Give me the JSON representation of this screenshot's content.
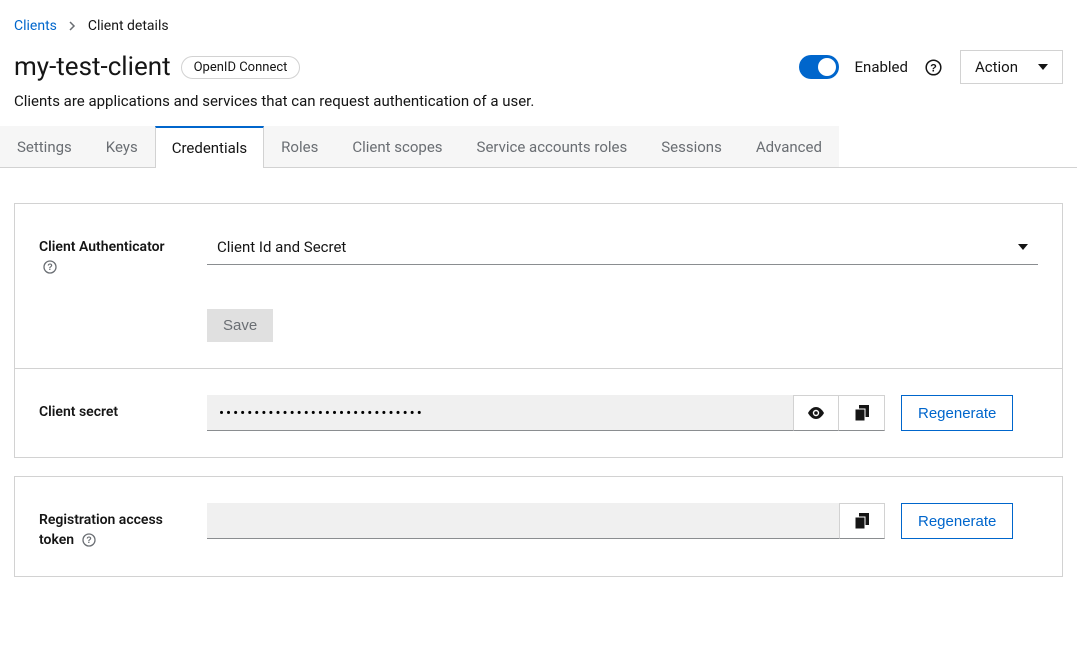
{
  "breadcrumb": {
    "root": "Clients",
    "current": "Client details"
  },
  "header": {
    "title": "my-test-client",
    "chip": "OpenID Connect",
    "enabled_label": "Enabled",
    "action_label": "Action"
  },
  "description": "Clients are applications and services that can request authentication of a user.",
  "tabs": {
    "settings": "Settings",
    "keys": "Keys",
    "credentials": "Credentials",
    "roles": "Roles",
    "client_scopes": "Client scopes",
    "service_accounts_roles": "Service accounts roles",
    "sessions": "Sessions",
    "advanced": "Advanced"
  },
  "form": {
    "authenticator": {
      "label": "Client Authenticator",
      "value": "Client Id and Secret",
      "save": "Save"
    },
    "secret": {
      "label": "Client secret",
      "value": "•••••••••••••••••••••••••••••",
      "regenerate": "Regenerate"
    },
    "registration_token": {
      "label": "Registration access token",
      "value": "",
      "regenerate": "Regenerate"
    }
  }
}
